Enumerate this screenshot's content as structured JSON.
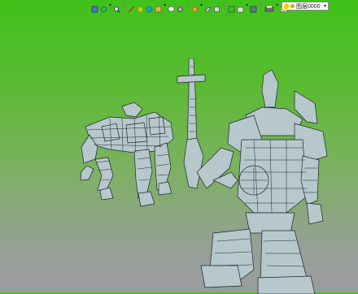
{
  "toolbar": {
    "icons": [
      "view-cube-icon",
      "orbit-icon",
      "zoom-icon",
      "sun-icon",
      "sphere-icon",
      "comment-icon",
      "gear-icon",
      "lamp-icon",
      "pen-icon",
      "plane-icon",
      "box-icon",
      "frame-icon",
      "cube-icon",
      "printer-icon",
      "rectangle-icon",
      "line-icon"
    ],
    "line_color": "#000000",
    "layer_dropdown": {
      "value": "图层0000"
    }
  },
  "viewport": {
    "models": [
      "robot-beast-model",
      "robot-warrior-model"
    ],
    "wire_color": "#1e2428",
    "part_color": "#b6c8cc"
  }
}
